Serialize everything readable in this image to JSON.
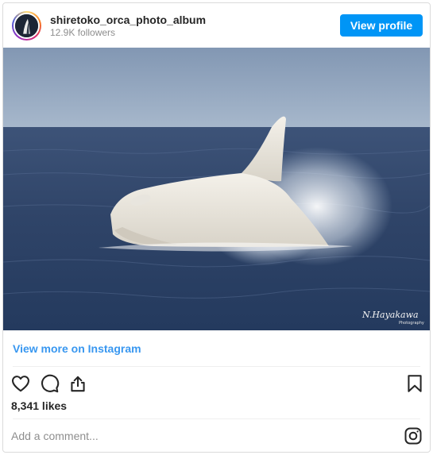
{
  "header": {
    "username": "shiretoko_orca_photo_album",
    "followers": "12.9K followers",
    "view_profile_label": "View profile"
  },
  "post": {
    "image_icon": "white-orca-photo",
    "watermark": "N.Hayakawa",
    "watermark_sub": "Photography",
    "view_more_label": "View more on Instagram",
    "likes": "8,341 likes",
    "comment_placeholder": "Add a comment..."
  },
  "icons": {
    "like": "heart-icon",
    "comment": "comment-icon",
    "share": "share-icon",
    "save": "bookmark-icon",
    "brand": "instagram-icon"
  },
  "colors": {
    "accent": "#0095f6",
    "link": "#3897f0",
    "text": "#262626",
    "muted": "#8e8e8e",
    "border": "#dbdbdb"
  }
}
